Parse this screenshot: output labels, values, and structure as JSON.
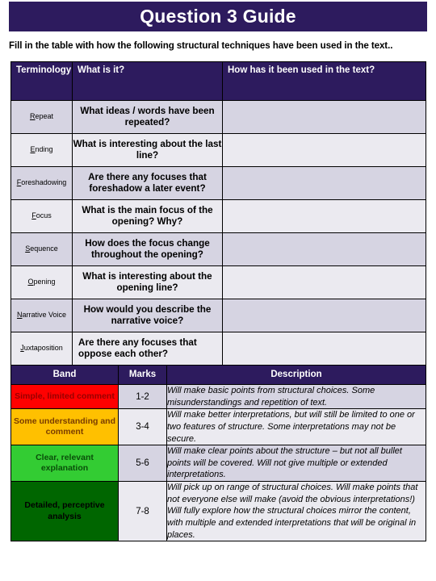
{
  "header": {
    "title": "Question 3 Guide",
    "title_bg": "#2D1B5E",
    "title_color": "#FFFFFF"
  },
  "instruction": "Fill in the table with how the following structural techniques have been used in the text..",
  "terminology_table": {
    "headers": {
      "terminology": "Terminology",
      "what_is_it": "What is it?",
      "how_used": "How has it been used in the text?"
    },
    "header_bg": "#2D1B5E",
    "row_bg_alt_a": "#D6D4E2",
    "row_bg_alt_b": "#EBEAF0",
    "rows": [
      {
        "term_first": "R",
        "term_rest": "epeat",
        "question": "What ideas / words have been repeated?",
        "answer": "",
        "align": "center"
      },
      {
        "term_first": "E",
        "term_rest": "nding",
        "question": "What is interesting about the last line?",
        "answer": "",
        "align": "center"
      },
      {
        "term_first": "F",
        "term_rest": "oreshadowing",
        "question": "Are there any focuses that foreshadow a later event?",
        "answer": "",
        "align": "center"
      },
      {
        "term_first": "F",
        "term_rest": "ocus",
        "question": "What is the main focus of the opening? Why?",
        "answer": "",
        "align": "center"
      },
      {
        "term_first": "S",
        "term_rest": "equence",
        "question": "How does the focus change throughout the opening?",
        "answer": "",
        "align": "center"
      },
      {
        "term_first": "O",
        "term_rest": "pening",
        "question": "What is interesting about the opening line?",
        "answer": "",
        "align": "center"
      },
      {
        "term_first": "N",
        "term_rest": "arrative Voice",
        "question": "How would you describe the narrative voice?",
        "answer": "",
        "align": "center"
      },
      {
        "term_first": "J",
        "term_rest": "uxtaposition",
        "question": "Are there any focuses that oppose each other?",
        "answer": "",
        "align": "left"
      }
    ]
  },
  "bands_table": {
    "headers": {
      "band": "Band",
      "marks": "Marks",
      "description": "Description"
    },
    "header_bg": "#2D1B5E",
    "rows": [
      {
        "band": "Simple, limited comment",
        "band_bg": "#FF0000",
        "band_text_color": "#990000",
        "marks": "1-2",
        "description": "Will make basic points from structural choices. Some misunderstandings and repetition of text.",
        "row_bg": "#D6D4E2"
      },
      {
        "band": "Some understanding and comment",
        "band_bg": "#FFC000",
        "band_text_color": "#7A3D00",
        "marks": "3-4",
        "description": "Will make better interpretations, but will still be limited to one or two features of structure. Some interpretations may not be secure.",
        "row_bg": "#EBEAF0"
      },
      {
        "band": "Clear, relevant explanation",
        "band_bg": "#33CC33",
        "band_text_color": "#0A4F0A",
        "marks": "5-6",
        "description": "Will make clear points about the structure – but not all bullet points will be covered. Will not give multiple or extended interpretations.",
        "row_bg": "#D6D4E2"
      },
      {
        "band": "Detailed, perceptive analysis",
        "band_bg": "#006600",
        "band_text_color": "#000000",
        "marks": "7-8",
        "description": "Will pick up on range of structural choices. Will make points that not everyone else will make (avoid the obvious interpretations!) Will fully explore how the structural choices mirror the content, with multiple and extended interpretations that will be original in places.",
        "row_bg": "#EBEAF0"
      }
    ]
  }
}
